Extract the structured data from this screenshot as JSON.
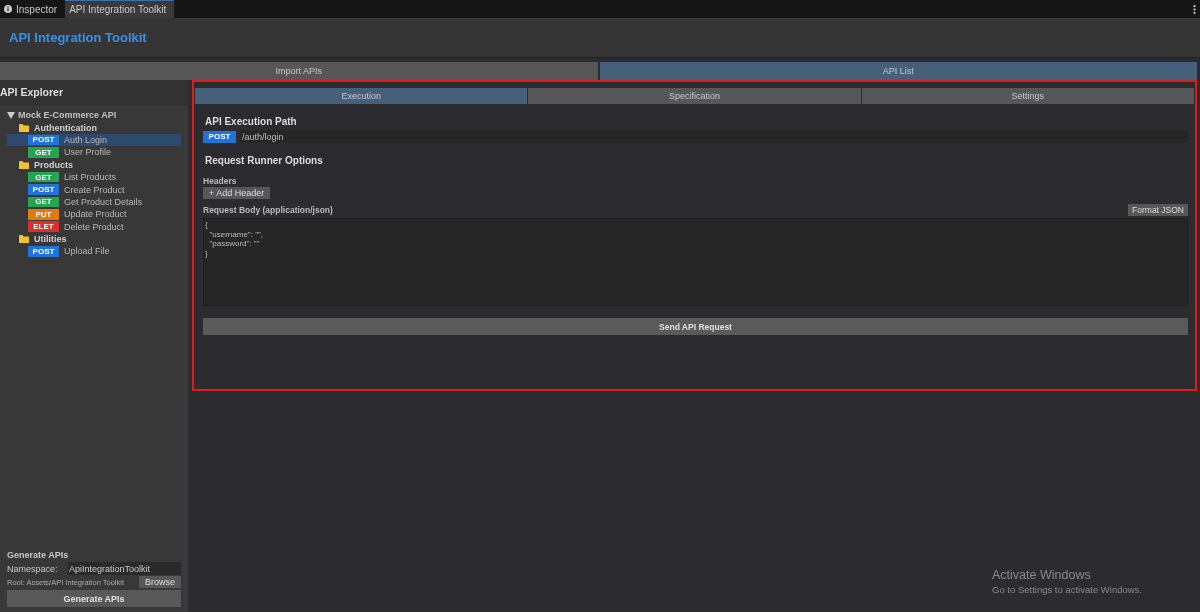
{
  "editor_tabs": [
    {
      "label": "Inspector",
      "selected": false
    },
    {
      "label": "API Integration Toolkit",
      "selected": true
    }
  ],
  "header": {
    "title": "API Integration Toolkit"
  },
  "main_tabs": [
    {
      "label": "Import APIs",
      "selected": false
    },
    {
      "label": "API List",
      "selected": true
    }
  ],
  "explorer": {
    "title": "API Explorer",
    "tree": [
      {
        "label": "Mock E-Commerce API",
        "expanded": true,
        "children": [
          {
            "label": "Authentication",
            "endpoints": [
              {
                "method": "POST",
                "color": "#1f73d9",
                "name": "Auth Login",
                "selected": true
              },
              {
                "method": "GET",
                "color": "#27a354",
                "name": "User Profile",
                "selected": false
              }
            ]
          },
          {
            "label": "Products",
            "endpoints": [
              {
                "method": "GET",
                "color": "#27a354",
                "name": "List Products",
                "selected": false
              },
              {
                "method": "POST",
                "color": "#1f73d9",
                "name": "Create Product",
                "selected": false
              },
              {
                "method": "GET",
                "color": "#27a354",
                "name": "Get Product Details",
                "selected": false
              },
              {
                "method": "PUT",
                "color": "#e07b12",
                "name": "Update Product",
                "selected": false
              },
              {
                "method": "ELET",
                "color": "#d9302c",
                "name": "Delete Product",
                "selected": false
              }
            ]
          },
          {
            "label": "Utilities",
            "endpoints": [
              {
                "method": "POST",
                "color": "#1f73d9",
                "name": "Upload File",
                "selected": false
              }
            ]
          }
        ]
      }
    ]
  },
  "generate": {
    "title": "Generate APIs",
    "namespace_label": "Namespace:",
    "namespace_value": "ApiIntegrationToolkit",
    "root": "Root: Assets/API Integration Toolkit",
    "browse": "Browse",
    "button": "Generate APIs"
  },
  "detail_tabs": [
    {
      "label": "Execution",
      "selected": true
    },
    {
      "label": "Specification",
      "selected": false
    },
    {
      "label": "Settings",
      "selected": false
    }
  ],
  "execution": {
    "path_title": "API Execution Path",
    "method": "POST",
    "path": "/auth/login",
    "options_title": "Request Runner Options",
    "headers_label": "Headers",
    "add_header": "+ Add Header",
    "body_label": "Request Body (application/json)",
    "format_button": "Format JSON",
    "body": "{\n  \"username\": \"\",\n  \"password\": \"\"\n}",
    "send_button": "Send API Request"
  },
  "os_notice": {
    "title": "Activate Windows",
    "text": "Go to Settings to activate Windows."
  }
}
